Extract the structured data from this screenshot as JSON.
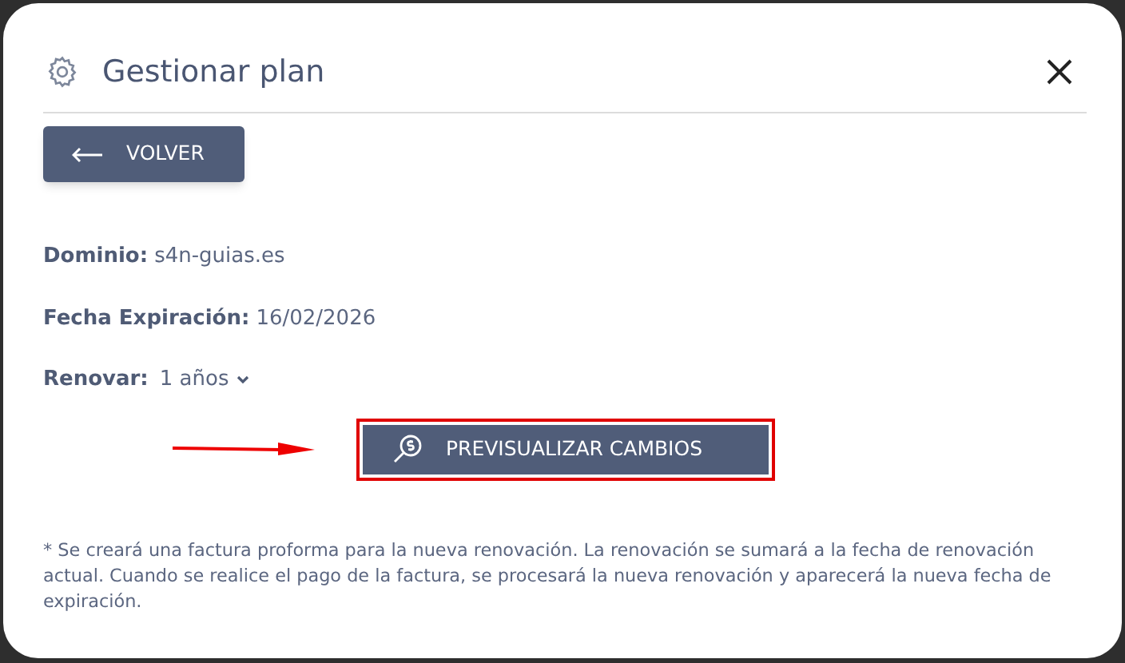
{
  "dialog": {
    "title": "Gestionar plan"
  },
  "back_button": {
    "label": "VOLVER"
  },
  "fields": [
    {
      "label": "Dominio:",
      "value": "s4n-guias.es"
    },
    {
      "label": "Fecha Expiración:",
      "value": "16/02/2026"
    }
  ],
  "renew": {
    "label": "Renovar:",
    "value": "1 años"
  },
  "preview_button": {
    "label": "PREVISUALIZAR CAMBIOS",
    "highlighted": true
  },
  "footnote": "* Se creará una factura proforma para la nueva renovación. La renovación se sumará a la fecha de renovación actual. Cuando se realice el pago de la factura, se procesará la nueva renovación y aparecerá la nueva fecha de expiración."
}
